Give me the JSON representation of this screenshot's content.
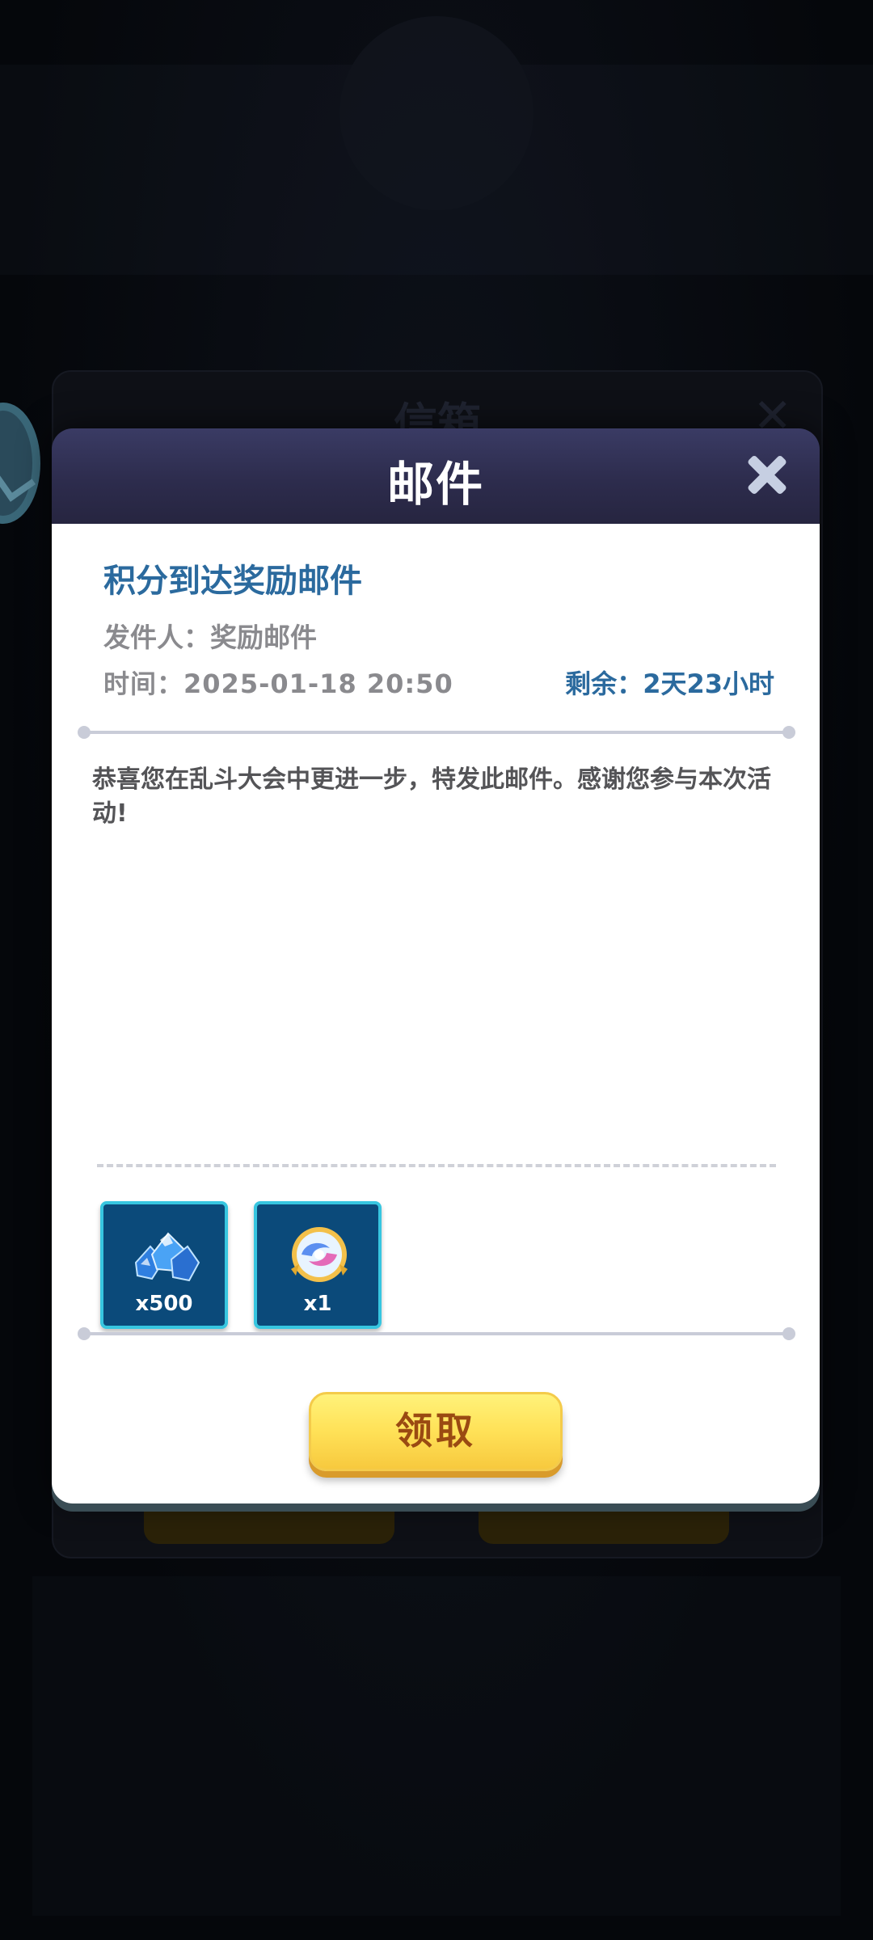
{
  "background_dialog": {
    "title": "信箱"
  },
  "mail_dialog": {
    "title": "邮件",
    "subject": "积分到达奖励邮件",
    "sender_label": "发件人：",
    "sender": "奖励邮件",
    "time_label": "时间：",
    "time": "2025-01-18 20:50",
    "remaining_label": "剩余：",
    "remaining": "2天23小时",
    "content": "恭喜您在乱斗大会中更进一步，特发此邮件。感谢您参与本次活动!",
    "rewards": [
      {
        "icon": "blue-gem-pile-icon",
        "count": "x500"
      },
      {
        "icon": "swirl-orb-icon",
        "count": "x1"
      }
    ],
    "claim_label": "领取"
  },
  "colors": {
    "header": "#2d2c4d",
    "subject": "#2b6a9e",
    "claim_button": "#ffe157",
    "reward_tile": "#0b4a7a"
  }
}
